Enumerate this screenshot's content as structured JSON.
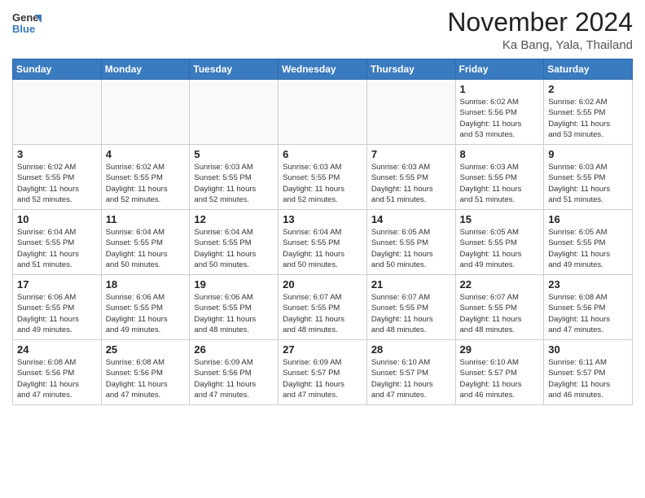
{
  "header": {
    "logo_general": "General",
    "logo_blue": "Blue",
    "month": "November 2024",
    "location": "Ka Bang, Yala, Thailand"
  },
  "weekdays": [
    "Sunday",
    "Monday",
    "Tuesday",
    "Wednesday",
    "Thursday",
    "Friday",
    "Saturday"
  ],
  "weeks": [
    [
      {
        "day": "",
        "info": ""
      },
      {
        "day": "",
        "info": ""
      },
      {
        "day": "",
        "info": ""
      },
      {
        "day": "",
        "info": ""
      },
      {
        "day": "",
        "info": ""
      },
      {
        "day": "1",
        "info": "Sunrise: 6:02 AM\nSunset: 5:56 PM\nDaylight: 11 hours\nand 53 minutes."
      },
      {
        "day": "2",
        "info": "Sunrise: 6:02 AM\nSunset: 5:55 PM\nDaylight: 11 hours\nand 53 minutes."
      }
    ],
    [
      {
        "day": "3",
        "info": "Sunrise: 6:02 AM\nSunset: 5:55 PM\nDaylight: 11 hours\nand 52 minutes."
      },
      {
        "day": "4",
        "info": "Sunrise: 6:02 AM\nSunset: 5:55 PM\nDaylight: 11 hours\nand 52 minutes."
      },
      {
        "day": "5",
        "info": "Sunrise: 6:03 AM\nSunset: 5:55 PM\nDaylight: 11 hours\nand 52 minutes."
      },
      {
        "day": "6",
        "info": "Sunrise: 6:03 AM\nSunset: 5:55 PM\nDaylight: 11 hours\nand 52 minutes."
      },
      {
        "day": "7",
        "info": "Sunrise: 6:03 AM\nSunset: 5:55 PM\nDaylight: 11 hours\nand 51 minutes."
      },
      {
        "day": "8",
        "info": "Sunrise: 6:03 AM\nSunset: 5:55 PM\nDaylight: 11 hours\nand 51 minutes."
      },
      {
        "day": "9",
        "info": "Sunrise: 6:03 AM\nSunset: 5:55 PM\nDaylight: 11 hours\nand 51 minutes."
      }
    ],
    [
      {
        "day": "10",
        "info": "Sunrise: 6:04 AM\nSunset: 5:55 PM\nDaylight: 11 hours\nand 51 minutes."
      },
      {
        "day": "11",
        "info": "Sunrise: 6:04 AM\nSunset: 5:55 PM\nDaylight: 11 hours\nand 50 minutes."
      },
      {
        "day": "12",
        "info": "Sunrise: 6:04 AM\nSunset: 5:55 PM\nDaylight: 11 hours\nand 50 minutes."
      },
      {
        "day": "13",
        "info": "Sunrise: 6:04 AM\nSunset: 5:55 PM\nDaylight: 11 hours\nand 50 minutes."
      },
      {
        "day": "14",
        "info": "Sunrise: 6:05 AM\nSunset: 5:55 PM\nDaylight: 11 hours\nand 50 minutes."
      },
      {
        "day": "15",
        "info": "Sunrise: 6:05 AM\nSunset: 5:55 PM\nDaylight: 11 hours\nand 49 minutes."
      },
      {
        "day": "16",
        "info": "Sunrise: 6:05 AM\nSunset: 5:55 PM\nDaylight: 11 hours\nand 49 minutes."
      }
    ],
    [
      {
        "day": "17",
        "info": "Sunrise: 6:06 AM\nSunset: 5:55 PM\nDaylight: 11 hours\nand 49 minutes."
      },
      {
        "day": "18",
        "info": "Sunrise: 6:06 AM\nSunset: 5:55 PM\nDaylight: 11 hours\nand 49 minutes."
      },
      {
        "day": "19",
        "info": "Sunrise: 6:06 AM\nSunset: 5:55 PM\nDaylight: 11 hours\nand 48 minutes."
      },
      {
        "day": "20",
        "info": "Sunrise: 6:07 AM\nSunset: 5:55 PM\nDaylight: 11 hours\nand 48 minutes."
      },
      {
        "day": "21",
        "info": "Sunrise: 6:07 AM\nSunset: 5:55 PM\nDaylight: 11 hours\nand 48 minutes."
      },
      {
        "day": "22",
        "info": "Sunrise: 6:07 AM\nSunset: 5:55 PM\nDaylight: 11 hours\nand 48 minutes."
      },
      {
        "day": "23",
        "info": "Sunrise: 6:08 AM\nSunset: 5:56 PM\nDaylight: 11 hours\nand 47 minutes."
      }
    ],
    [
      {
        "day": "24",
        "info": "Sunrise: 6:08 AM\nSunset: 5:56 PM\nDaylight: 11 hours\nand 47 minutes."
      },
      {
        "day": "25",
        "info": "Sunrise: 6:08 AM\nSunset: 5:56 PM\nDaylight: 11 hours\nand 47 minutes."
      },
      {
        "day": "26",
        "info": "Sunrise: 6:09 AM\nSunset: 5:56 PM\nDaylight: 11 hours\nand 47 minutes."
      },
      {
        "day": "27",
        "info": "Sunrise: 6:09 AM\nSunset: 5:57 PM\nDaylight: 11 hours\nand 47 minutes."
      },
      {
        "day": "28",
        "info": "Sunrise: 6:10 AM\nSunset: 5:57 PM\nDaylight: 11 hours\nand 47 minutes."
      },
      {
        "day": "29",
        "info": "Sunrise: 6:10 AM\nSunset: 5:57 PM\nDaylight: 11 hours\nand 46 minutes."
      },
      {
        "day": "30",
        "info": "Sunrise: 6:11 AM\nSunset: 5:57 PM\nDaylight: 11 hours\nand 46 minutes."
      }
    ]
  ]
}
